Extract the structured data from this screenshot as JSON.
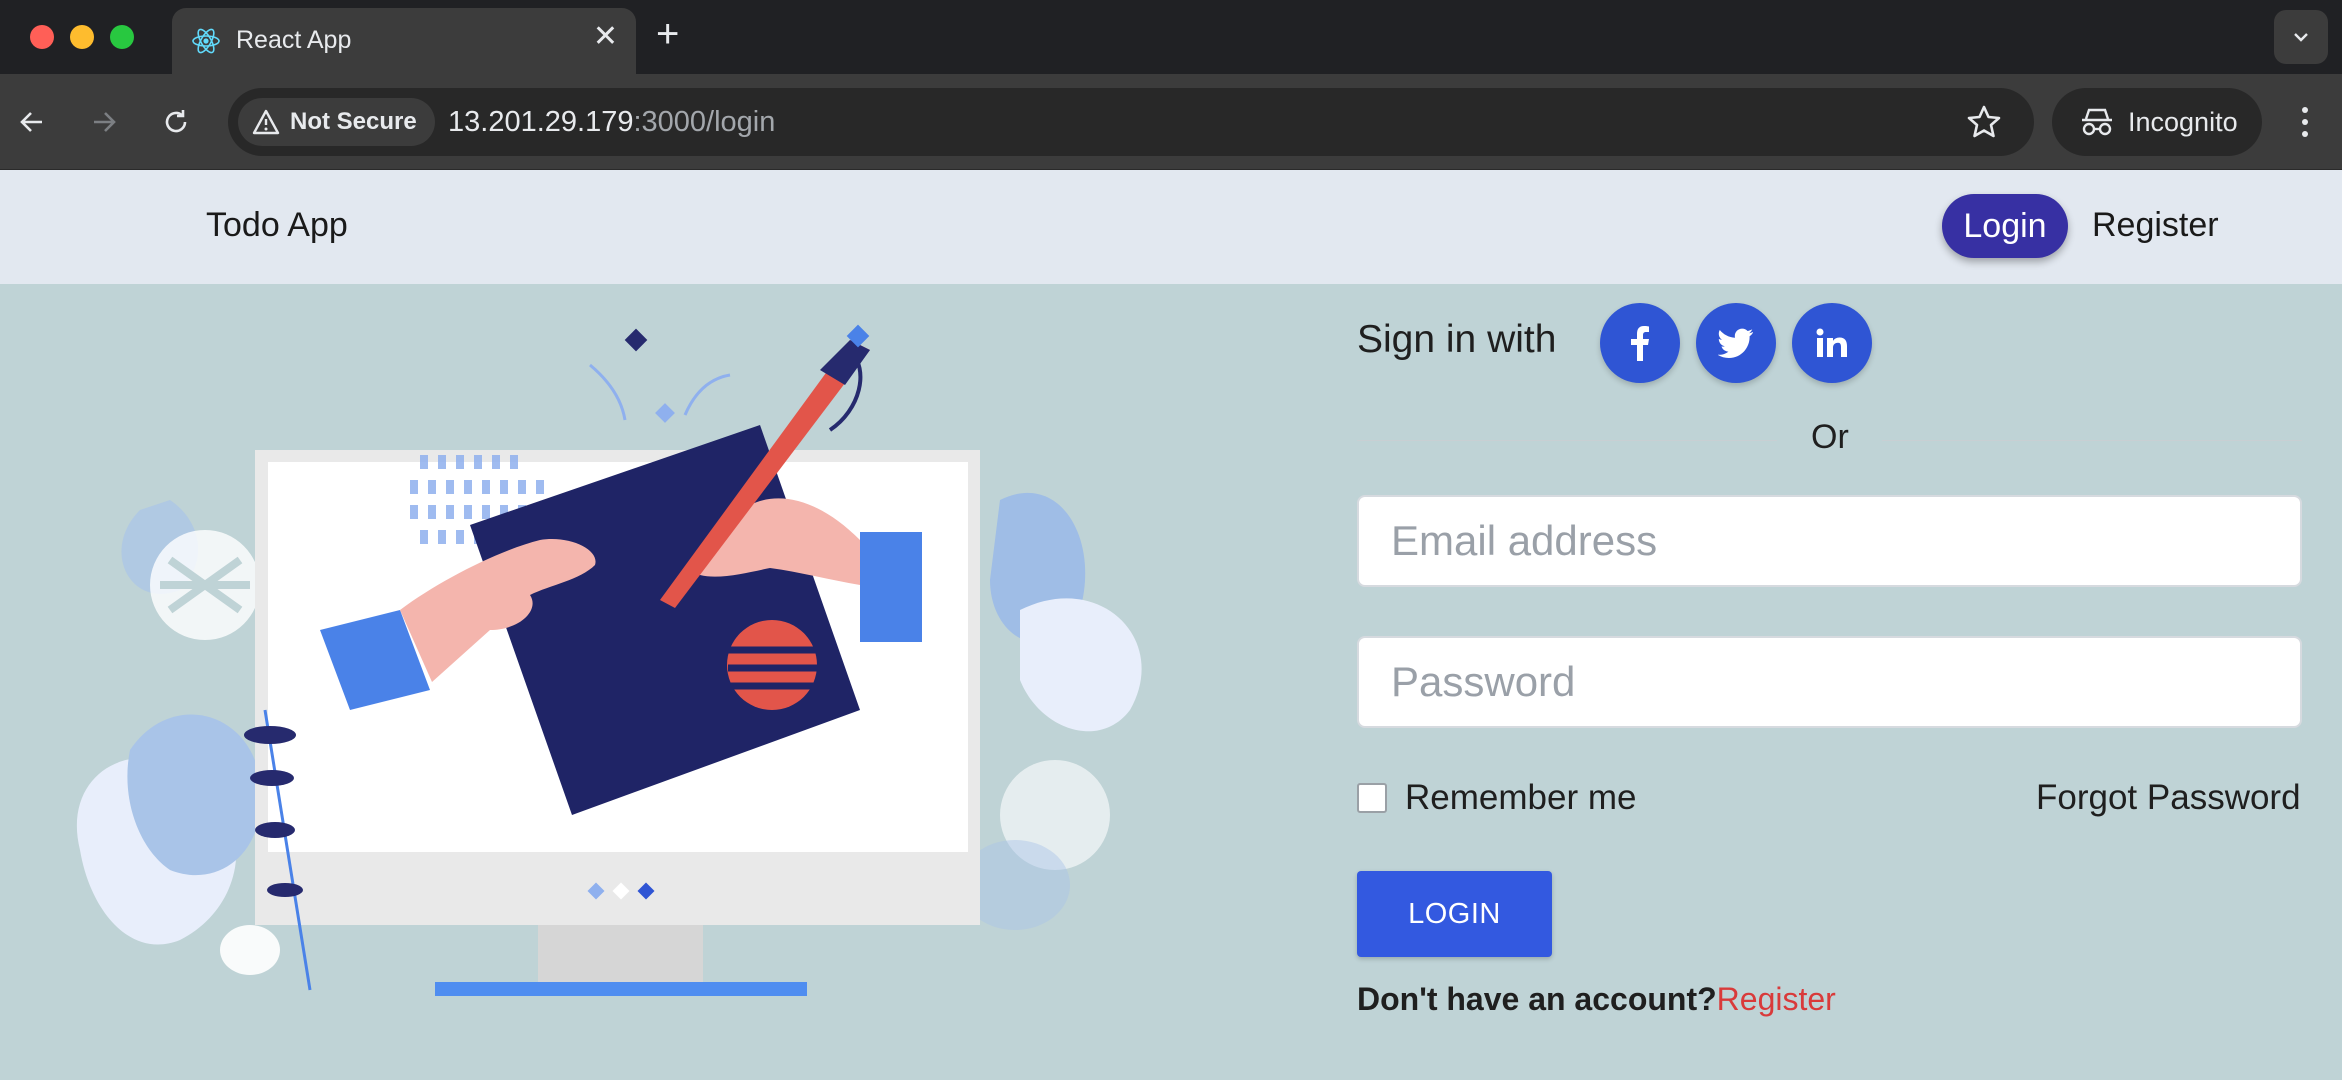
{
  "browser": {
    "tab_title": "React App",
    "security_label": "Not Secure",
    "url_host": "13.201.29.179",
    "url_rest": ":3000/login",
    "profile_label": "Incognito"
  },
  "navbar": {
    "brand": "Todo App",
    "login_label": "Login",
    "register_label": "Register"
  },
  "form": {
    "signin_text": "Sign in with",
    "or_text": "Or",
    "email_placeholder": "Email address",
    "password_placeholder": "Password",
    "remember_label": "Remember me",
    "forgot_label": "Forgot Password",
    "login_button": "LOGIN",
    "no_account_text": "Don't have an account?",
    "register_link": "Register"
  },
  "colors": {
    "primary": "#3359e0",
    "nav_active": "#3730a3",
    "page_bg": "#bfd3d6",
    "link_red": "#d93a3a"
  },
  "icons": {
    "social": [
      "facebook-icon",
      "twitter-icon",
      "linkedin-icon"
    ]
  }
}
